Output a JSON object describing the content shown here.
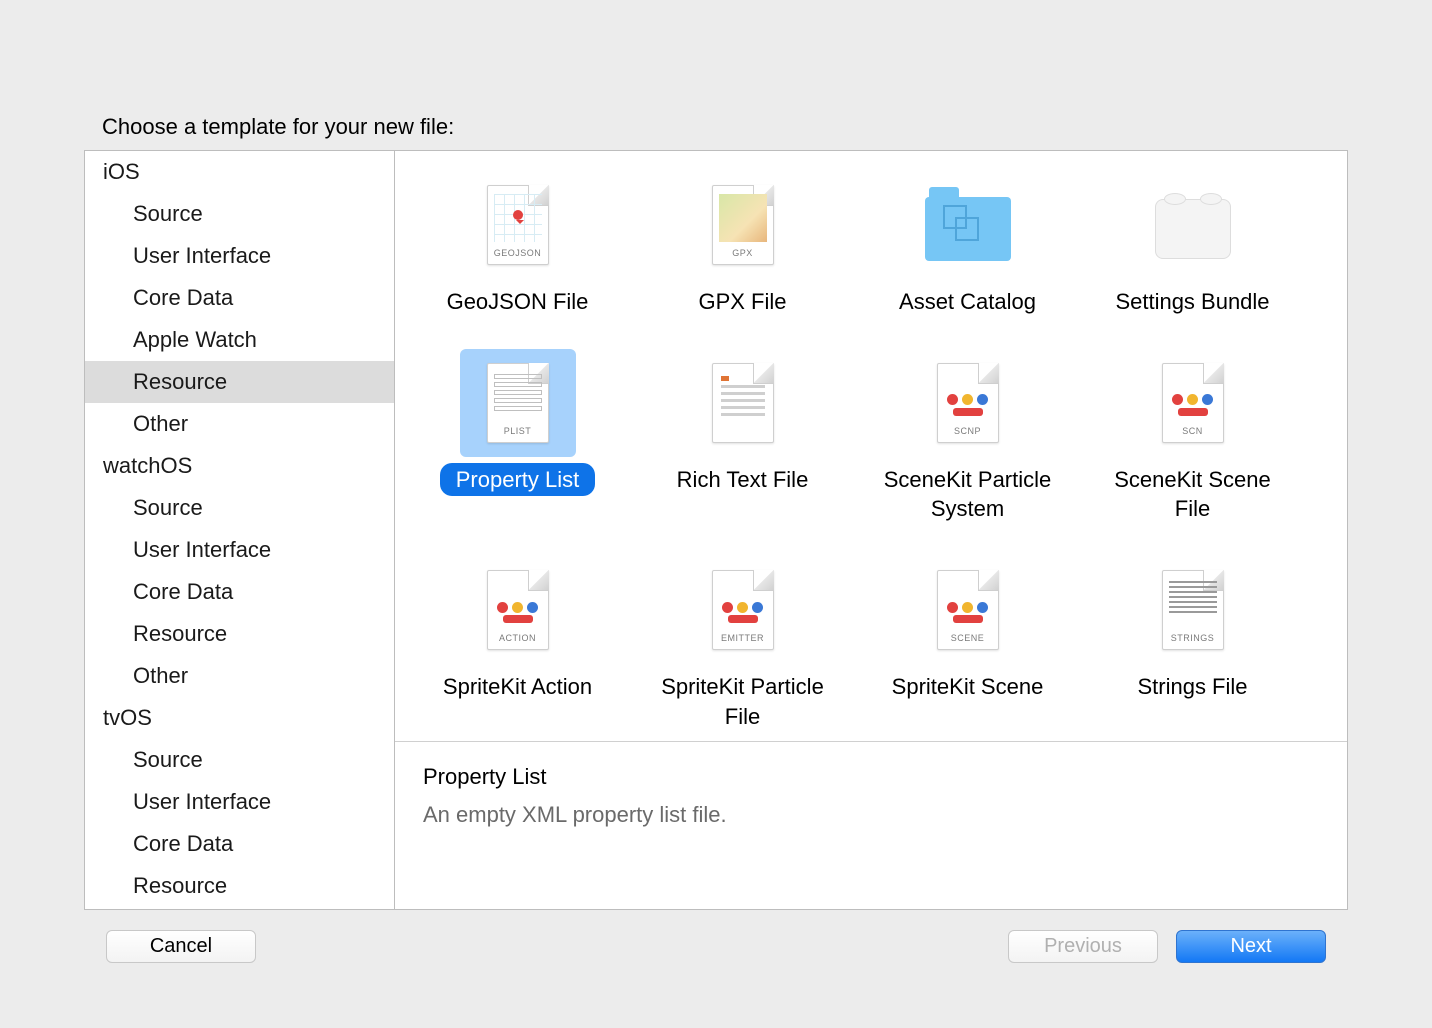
{
  "header_title": "Choose a template for your new file:",
  "sidebar": {
    "platforms": [
      {
        "label": "iOS",
        "categories": [
          {
            "label": "Source",
            "selected": false
          },
          {
            "label": "User Interface",
            "selected": false
          },
          {
            "label": "Core Data",
            "selected": false
          },
          {
            "label": "Apple Watch",
            "selected": false
          },
          {
            "label": "Resource",
            "selected": true
          },
          {
            "label": "Other",
            "selected": false
          }
        ]
      },
      {
        "label": "watchOS",
        "categories": [
          {
            "label": "Source",
            "selected": false
          },
          {
            "label": "User Interface",
            "selected": false
          },
          {
            "label": "Core Data",
            "selected": false
          },
          {
            "label": "Resource",
            "selected": false
          },
          {
            "label": "Other",
            "selected": false
          }
        ]
      },
      {
        "label": "tvOS",
        "categories": [
          {
            "label": "Source",
            "selected": false
          },
          {
            "label": "User Interface",
            "selected": false
          },
          {
            "label": "Core Data",
            "selected": false
          },
          {
            "label": "Resource",
            "selected": false
          }
        ]
      }
    ]
  },
  "templates": [
    {
      "label": "GeoJSON File",
      "ext": "GEOJSON",
      "art": "geojson",
      "selected": false
    },
    {
      "label": "GPX File",
      "ext": "GPX",
      "art": "gpx",
      "selected": false
    },
    {
      "label": "Asset Catalog",
      "ext": "",
      "art": "folder",
      "selected": false
    },
    {
      "label": "Settings Bundle",
      "ext": "",
      "art": "brick",
      "selected": false
    },
    {
      "label": "Property List",
      "ext": "PLIST",
      "art": "plist",
      "selected": true
    },
    {
      "label": "Rich Text File",
      "ext": "",
      "art": "text",
      "selected": false
    },
    {
      "label": "SceneKit Particle System",
      "ext": "SCNP",
      "art": "dots",
      "selected": false
    },
    {
      "label": "SceneKit Scene File",
      "ext": "SCN",
      "art": "dots",
      "selected": false
    },
    {
      "label": "SpriteKit Action",
      "ext": "ACTION",
      "art": "dots",
      "selected": false
    },
    {
      "label": "SpriteKit Particle File",
      "ext": "EMITTER",
      "art": "dots",
      "selected": false
    },
    {
      "label": "SpriteKit Scene",
      "ext": "SCENE",
      "art": "dots",
      "selected": false
    },
    {
      "label": "Strings File",
      "ext": "STRINGS",
      "art": "strings",
      "selected": false
    }
  ],
  "description": {
    "title": "Property List",
    "subtitle": "An empty XML property list file."
  },
  "buttons": {
    "cancel": "Cancel",
    "previous": "Previous",
    "next": "Next"
  }
}
